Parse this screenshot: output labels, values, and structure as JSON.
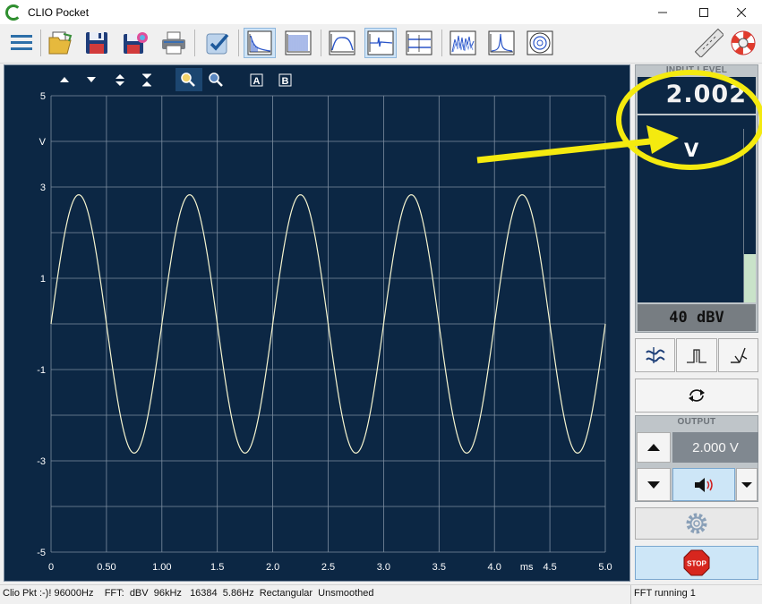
{
  "window": {
    "title": "CLIO Pocket",
    "minimize_icon": "minimize-icon",
    "maximize_icon": "maximize-icon",
    "close_icon": "close-icon"
  },
  "toolbar": {
    "buttons": [
      {
        "name": "menu",
        "icon": "hamburger-menu-icon"
      },
      {
        "name": "open",
        "icon": "open-folder-icon"
      },
      {
        "name": "save",
        "icon": "save-disk-icon"
      },
      {
        "name": "save-all",
        "icon": "save-all-icon"
      },
      {
        "name": "print",
        "icon": "printer-icon"
      },
      {
        "name": "check",
        "icon": "checkmark-icon"
      },
      {
        "name": "fft",
        "icon": "fft-icon"
      },
      {
        "name": "sweep",
        "icon": "sweep-icon"
      },
      {
        "name": "frequency-response",
        "icon": "frequency-response-icon"
      },
      {
        "name": "oscilloscope",
        "icon": "oscilloscope-icon"
      },
      {
        "name": "meter",
        "icon": "meter-icon"
      },
      {
        "name": "waterfall",
        "icon": "waterfall-icon"
      },
      {
        "name": "impulse",
        "icon": "impulse-icon"
      },
      {
        "name": "spectrum",
        "icon": "spectrum-icon"
      },
      {
        "name": "polar",
        "icon": "polar-icon"
      },
      {
        "name": "ruler",
        "icon": "ruler-icon"
      },
      {
        "name": "help",
        "icon": "lifebuoy-icon"
      }
    ]
  },
  "plot_toolbar": {
    "buttons": [
      "arrow-up-icon",
      "arrow-down-icon",
      "expand-vertical-icon",
      "compress-vertical-icon",
      "zoom-in-icon",
      "zoom-out-icon"
    ],
    "cursor_a_label": "A",
    "cursor_b_label": "B"
  },
  "chart_data": {
    "type": "line",
    "ylabel": "V",
    "xlabel": "ms",
    "ylim": [
      -5,
      5
    ],
    "xlim": [
      0,
      5.0
    ],
    "y_ticks": [
      "5",
      "3",
      "1",
      "-1",
      "-3",
      "-5"
    ],
    "x_ticks": [
      "0",
      "0.50",
      "1.00",
      "1.5",
      "2.0",
      "2.5",
      "3.0",
      "3.5",
      "4.0",
      "4.5",
      "5.0"
    ],
    "grid": true,
    "series": [
      {
        "amplitude": 2.83,
        "frequency_khz": 1.0,
        "phase_deg": 0,
        "color": "#f6f5cf"
      }
    ]
  },
  "input_level": {
    "caption": "INPUT LEVEL",
    "value": "2.002",
    "unit": "V",
    "bar_fraction": 0.28,
    "range": "40 dBV",
    "buttons": [
      "ac-coupling-icon",
      "pulse-icon",
      "probe-icon"
    ]
  },
  "loop_button_icon": "loop-icon",
  "output": {
    "caption": "OUTPUT",
    "value": "2.000 V",
    "up_icon": "triangle-up-icon",
    "down_icon": "triangle-down-icon",
    "speaker_icon": "speaker-icon",
    "dropdown_icon": "dropdown-arrow-icon"
  },
  "settings_icon": "gear-icon",
  "stop_label": "STOP",
  "status": {
    "left": "Clio Pkt :-)! 96000Hz    FFT:  dBV  96kHz   16384  5.86Hz  Rectangular  Unsmoothed",
    "right": "FFT running 1"
  },
  "colors": {
    "plot_bg": "#0c2744",
    "grid": "#7d8ea0",
    "trace": "#f6f5cf",
    "annotation": "#f4ea0f"
  }
}
